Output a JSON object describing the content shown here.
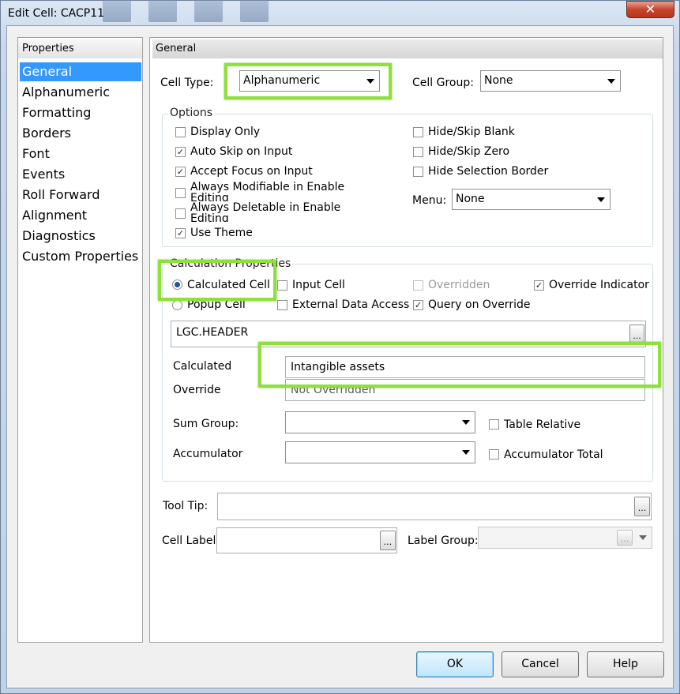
{
  "window": {
    "title": "Edit Cell: CACP11",
    "close_glyph": "✕"
  },
  "left_panel": {
    "header": "Properties",
    "items": [
      "General",
      "Alphanumeric",
      "Formatting",
      "Borders",
      "Font",
      "Events",
      "Roll Forward",
      "Alignment",
      "Diagnostics",
      "Custom Properties"
    ],
    "selected": "General"
  },
  "general": {
    "header": "General",
    "cell_type_label": "Cell Type:",
    "cell_type_value": "Alphanumeric",
    "cell_group_label": "Cell Group:",
    "cell_group_value": "None"
  },
  "options": {
    "title": "Options",
    "display_only": "Display Only",
    "auto_skip": "Auto Skip on Input",
    "accept_focus": "Accept Focus on Input",
    "always_modifiable": "Always Modifiable in Enable Editing",
    "always_deletable": "Always Deletable in Enable Editing",
    "use_theme": "Use Theme",
    "hide_skip_blank": "Hide/Skip Blank",
    "hide_skip_zero": "Hide/Skip Zero",
    "hide_selection_border": "Hide Selection Border",
    "menu_label": "Menu:",
    "menu_value": "None",
    "checked": {
      "display_only": false,
      "auto_skip": true,
      "accept_focus": true,
      "always_modifiable": false,
      "always_deletable": false,
      "use_theme": true,
      "hide_skip_blank": false,
      "hide_skip_zero": false,
      "hide_selection_border": false
    }
  },
  "calc": {
    "title": "Calculation Properties",
    "calculated_cell": "Calculated Cell",
    "popup_cell": "Popup Cell",
    "input_cell": "Input Cell",
    "external_data": "External Data Access",
    "overridden": "Overridden",
    "query_on_override": "Query on Override",
    "override_indicator": "Override Indicator",
    "formula": "LGC.HEADER",
    "calculated_label": "Calculated",
    "calculated_value": "Intangible assets",
    "override_label": "Override",
    "override_value": "Not Overridden",
    "sum_group_label": "Sum Group:",
    "accumulator_label": "Accumulator",
    "table_relative": "Table Relative",
    "accumulator_total": "Accumulator Total",
    "ellipsis": "..."
  },
  "bottom": {
    "tooltip_label": "Tool Tip:",
    "cell_label_label": "Cell Label:",
    "label_group_label": "Label Group:",
    "ellipsis": "..."
  },
  "buttons": {
    "ok": "OK",
    "cancel": "Cancel",
    "help": "Help"
  },
  "check_glyph": "✓"
}
